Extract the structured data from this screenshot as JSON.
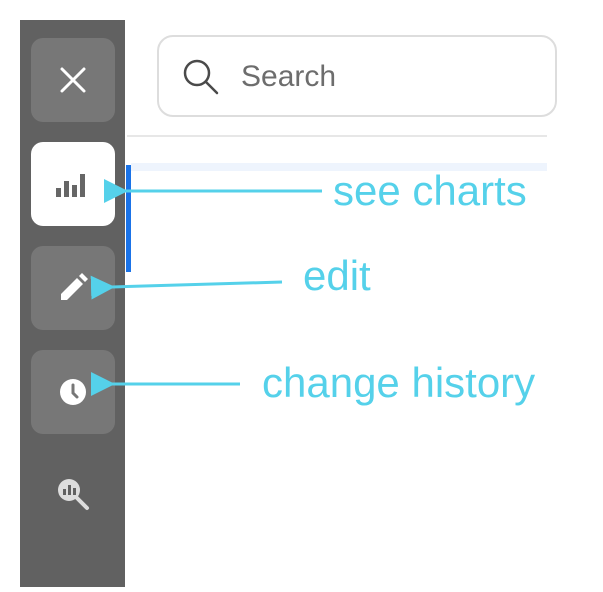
{
  "search": {
    "placeholder": "Search",
    "icon": "search-icon"
  },
  "sidebar": {
    "items": [
      {
        "icon": "close-icon",
        "active": false
      },
      {
        "icon": "bar-chart-icon",
        "active": true
      },
      {
        "icon": "pencil-icon",
        "active": false
      },
      {
        "icon": "clock-icon",
        "active": false
      },
      {
        "icon": "chart-search-icon",
        "active": false
      }
    ]
  },
  "annotations": {
    "charts": "see charts",
    "edit": "edit",
    "history": "change history"
  },
  "colors": {
    "sidebar_bg": "#616161",
    "button_bg": "#777777",
    "active_bg": "#ffffff",
    "indicator": "#1a73e8",
    "annotation": "#55d1ea"
  }
}
